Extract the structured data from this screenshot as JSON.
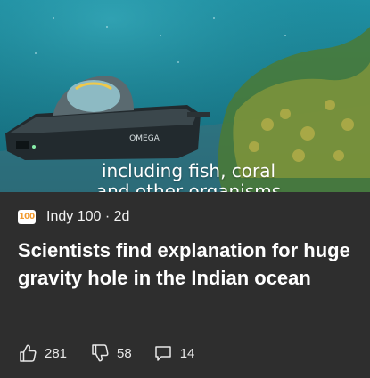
{
  "article": {
    "image_caption_line1": "including fish, coral",
    "image_caption_line2": "and other organisms",
    "submarine_brand": "OMEGA",
    "source_logo_text": "100",
    "source_line": "Indy 100 · 2d",
    "title": "Scientists find explanation for huge gravity hole in the Indian ocean"
  },
  "actions": {
    "likes": "281",
    "dislikes": "58",
    "comments": "14"
  },
  "icons": {
    "like": "thumbs-up-icon",
    "dislike": "thumbs-down-icon",
    "comment": "comment-icon"
  },
  "colors": {
    "card_background": "#2e2e2e",
    "water": "#1a7d8e",
    "logo_accent": "#f29a2e"
  }
}
